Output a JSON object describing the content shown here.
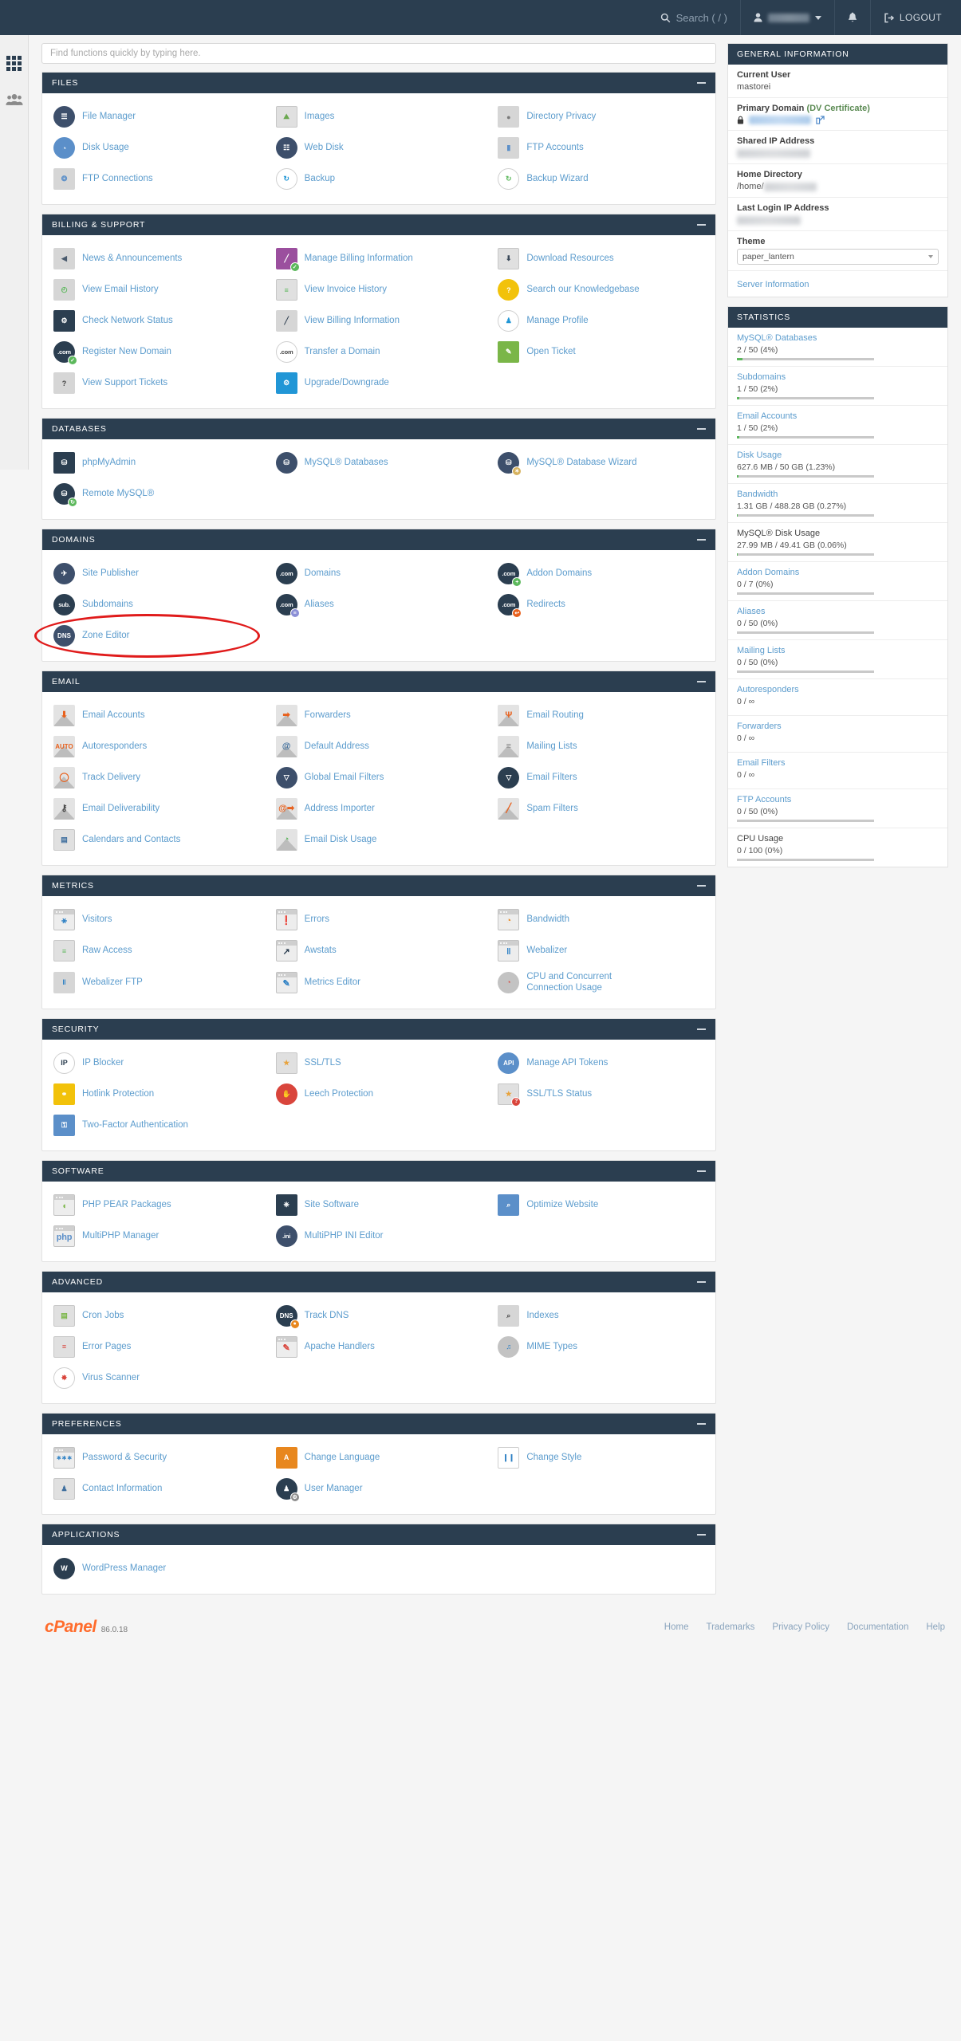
{
  "topnav": {
    "search_label": "Search ( / )",
    "search_icon": "search-icon",
    "user_name_redacted": "",
    "notifications_icon": "bell-icon",
    "logout_label": "LOGOUT"
  },
  "rail": {
    "items": [
      {
        "name": "apps-grid",
        "icon": "grid-icon"
      },
      {
        "name": "user-manager",
        "icon": "users-icon"
      }
    ]
  },
  "search": {
    "placeholder": "Find functions quickly by typing here."
  },
  "sections": [
    {
      "id": "files",
      "title": "FILES",
      "items": [
        {
          "label": "File Manager",
          "icon": "file-cabinet-icon",
          "cls": "ic circle ic-navy",
          "glyph": "☰"
        },
        {
          "label": "Images",
          "icon": "images-icon",
          "cls": "ic sq ic-silver",
          "glyph": "⛰",
          "gcolor": "#6aa84f"
        },
        {
          "label": "Directory Privacy",
          "icon": "folder-lock-icon",
          "cls": "ic sq ic-gray",
          "glyph": "●",
          "gcolor": "#7a7a7a"
        },
        {
          "label": "Disk Usage",
          "icon": "disk-usage-icon",
          "cls": "ic circle ic-ltblue",
          "glyph": "◔"
        },
        {
          "label": "Web Disk",
          "icon": "web-disk-icon",
          "cls": "ic circle ic-navy",
          "glyph": "☷"
        },
        {
          "label": "FTP Accounts",
          "icon": "ftp-truck-icon",
          "cls": "ic sq ic-gray",
          "glyph": "▮",
          "gcolor": "#5b8fc9"
        },
        {
          "label": "FTP Connections",
          "icon": "ftp-connections-icon",
          "cls": "ic sq ic-gray",
          "glyph": "❂",
          "gcolor": "#5b8fc9"
        },
        {
          "label": "Backup",
          "icon": "backup-icon",
          "cls": "ic circle ic-white",
          "glyph": "↻",
          "gcolor": "#2196d6"
        },
        {
          "label": "Backup Wizard",
          "icon": "backup-wizard-icon",
          "cls": "ic circle ic-white",
          "glyph": "↻",
          "gcolor": "#5cb85c"
        }
      ]
    },
    {
      "id": "billing",
      "title": "BILLING & SUPPORT",
      "items": [
        {
          "label": "News & Announcements",
          "icon": "megaphone-icon",
          "cls": "ic sq ic-gray",
          "glyph": "◀",
          "gcolor": "#4a5b6e"
        },
        {
          "label": "Manage Billing Information",
          "icon": "credit-card-icon",
          "cls": "ic sq ic-purple",
          "glyph": "╱",
          "badge": "✓",
          "bcolor": "#5cb85c"
        },
        {
          "label": "Download Resources",
          "icon": "download-doc-icon",
          "cls": "ic sq ic-silver",
          "glyph": "⬇",
          "gcolor": "#3b4a5a"
        },
        {
          "label": "View Email History",
          "icon": "email-history-icon",
          "cls": "ic sq ic-gray",
          "glyph": "◴",
          "gcolor": "#5cb85c"
        },
        {
          "label": "View Invoice History",
          "icon": "invoice-icon",
          "cls": "ic sq ic-silver",
          "glyph": "≡",
          "gcolor": "#5cb85c"
        },
        {
          "label": "Search our Knowledgebase",
          "icon": "lightbulb-icon",
          "cls": "ic circle ic-yellow",
          "glyph": "?"
        },
        {
          "label": "Check Network Status",
          "icon": "network-status-icon",
          "cls": "ic sq ic-dark",
          "glyph": "⚙"
        },
        {
          "label": "View Billing Information",
          "icon": "billing-card-icon",
          "cls": "ic sq ic-gray",
          "glyph": "╱",
          "gcolor": "#3b4a5a"
        },
        {
          "label": "Manage Profile",
          "icon": "profile-icon",
          "cls": "ic circle ic-white",
          "glyph": "♟",
          "gcolor": "#2196d6"
        },
        {
          "label": "Register New Domain",
          "icon": "register-domain-icon",
          "cls": "ic circle ic-dark",
          "glyph": ".com",
          "badge": "✓",
          "bcolor": "#5cb85c"
        },
        {
          "label": "Transfer a Domain",
          "icon": "transfer-domain-icon",
          "cls": "ic circle ic-white",
          "glyph": ".com",
          "gcolor": "#444"
        },
        {
          "label": "Open Ticket",
          "icon": "ticket-icon",
          "cls": "ic sq ic-grn2",
          "glyph": "✎"
        },
        {
          "label": "View Support Tickets",
          "icon": "support-ticket-icon",
          "cls": "ic sq ic-gray",
          "glyph": "?",
          "gcolor": "#444"
        },
        {
          "label": "Upgrade/Downgrade",
          "icon": "upgrade-icon",
          "cls": "ic sq ic-blue",
          "glyph": "⚙"
        }
      ]
    },
    {
      "id": "databases",
      "title": "DATABASES",
      "items": [
        {
          "label": "phpMyAdmin",
          "icon": "phpmyadmin-icon",
          "cls": "ic sq ic-dark",
          "glyph": "⛁"
        },
        {
          "label": "MySQL® Databases",
          "icon": "mysql-db-icon",
          "cls": "ic circle ic-navy",
          "glyph": "⛁"
        },
        {
          "label": "MySQL® Database Wizard",
          "icon": "mysql-wizard-icon",
          "cls": "ic circle ic-navy",
          "glyph": "⛁",
          "badge": "✶",
          "bcolor": "#d6b25e"
        },
        {
          "label": "Remote MySQL®",
          "icon": "remote-mysql-icon",
          "cls": "ic circle ic-dark",
          "glyph": "⛁",
          "badge": "↻",
          "bcolor": "#5cb85c"
        }
      ]
    },
    {
      "id": "domains",
      "title": "DOMAINS",
      "items": [
        {
          "label": "Site Publisher",
          "icon": "site-publisher-icon",
          "cls": "ic circle ic-navy",
          "glyph": "✈"
        },
        {
          "label": "Domains",
          "icon": "domains-icon",
          "cls": "ic circle ic-dark",
          "glyph": ".com"
        },
        {
          "label": "Addon Domains",
          "icon": "addon-domains-icon",
          "cls": "ic circle ic-dark",
          "glyph": ".com",
          "badge": "+",
          "bcolor": "#5cb85c"
        },
        {
          "label": "Subdomains",
          "icon": "subdomains-icon",
          "cls": "ic circle ic-dark",
          "glyph": "sub."
        },
        {
          "label": "Aliases",
          "icon": "aliases-icon",
          "cls": "ic circle ic-dark",
          "glyph": ".com",
          "badge": "≡",
          "bcolor": "#8b8fd6"
        },
        {
          "label": "Redirects",
          "icon": "redirects-icon",
          "cls": "ic circle ic-dark",
          "glyph": ".com",
          "badge": "↩",
          "bcolor": "#e8601c"
        },
        {
          "label": "Zone Editor",
          "icon": "zone-editor-icon",
          "cls": "ic circle ic-navy",
          "glyph": "DNS"
        }
      ]
    },
    {
      "id": "email",
      "title": "EMAIL",
      "items": [
        {
          "label": "Email Accounts",
          "icon": "email-accounts-icon",
          "cls": "ic env",
          "glyph": "⬇"
        },
        {
          "label": "Forwarders",
          "icon": "forwarders-icon",
          "cls": "ic env",
          "glyph": "➡"
        },
        {
          "label": "Email Routing",
          "icon": "email-routing-icon",
          "cls": "ic env",
          "glyph": "Ψ"
        },
        {
          "label": "Autoresponders",
          "icon": "autoresponders-icon",
          "cls": "ic env",
          "glyph": "AUTO"
        },
        {
          "label": "Default Address",
          "icon": "default-address-icon",
          "cls": "ic env",
          "glyph": "@",
          "gcolor": "#3f6f9e"
        },
        {
          "label": "Mailing Lists",
          "icon": "mailing-lists-icon",
          "cls": "ic env",
          "glyph": "≡",
          "gcolor": "#8c8c8c"
        },
        {
          "label": "Track Delivery",
          "icon": "track-delivery-icon",
          "cls": "ic env",
          "glyph": "◯"
        },
        {
          "label": "Global Email Filters",
          "icon": "global-filters-icon",
          "cls": "ic circle ic-navy",
          "glyph": "▽"
        },
        {
          "label": "Email Filters",
          "icon": "email-filters-icon",
          "cls": "ic circle ic-dark",
          "glyph": "▽"
        },
        {
          "label": "Email Deliverability",
          "icon": "deliverability-icon",
          "cls": "ic env",
          "glyph": "⚷",
          "gcolor": "#444"
        },
        {
          "label": "Address Importer",
          "icon": "address-importer-icon",
          "cls": "ic env",
          "glyph": "@➡"
        },
        {
          "label": "Spam Filters",
          "icon": "spam-filters-icon",
          "cls": "ic env",
          "glyph": "╱"
        },
        {
          "label": "Calendars and Contacts",
          "icon": "calendar-icon",
          "cls": "ic sq ic-silver",
          "glyph": "▤",
          "gcolor": "#3f6f9e"
        },
        {
          "label": "Email Disk Usage",
          "icon": "email-disk-usage-icon",
          "cls": "ic env",
          "glyph": "◔",
          "gcolor": "#5cb85c"
        }
      ]
    },
    {
      "id": "metrics",
      "title": "METRICS",
      "items": [
        {
          "label": "Visitors",
          "icon": "visitors-icon",
          "cls": "ic win",
          "glyph": "⚹",
          "gcolor": "#2b7fc4"
        },
        {
          "label": "Errors",
          "icon": "errors-icon",
          "cls": "ic win",
          "glyph": "❗",
          "gcolor": "#d9453c"
        },
        {
          "label": "Bandwidth",
          "icon": "bandwidth-icon",
          "cls": "ic win",
          "glyph": "◔",
          "gcolor": "#e8871e"
        },
        {
          "label": "Raw Access",
          "icon": "raw-access-icon",
          "cls": "ic sq ic-silver",
          "glyph": "≡",
          "gcolor": "#5cb85c"
        },
        {
          "label": "Awstats",
          "icon": "awstats-icon",
          "cls": "ic win",
          "glyph": "↗",
          "gcolor": "#2b3e50"
        },
        {
          "label": "Webalizer",
          "icon": "webalizer-icon",
          "cls": "ic win",
          "glyph": "‖",
          "gcolor": "#2b7fc4"
        },
        {
          "label": "Webalizer FTP",
          "icon": "webalizer-ftp-icon",
          "cls": "ic sq ic-gray",
          "glyph": "‖",
          "gcolor": "#2b7fc4"
        },
        {
          "label": "Metrics Editor",
          "icon": "metrics-editor-icon",
          "cls": "ic win",
          "glyph": "✎",
          "gcolor": "#2b7fc4"
        },
        {
          "label": "CPU and Concurrent Connection Usage",
          "icon": "cpu-usage-icon",
          "cls": "ic circle ic-gray2",
          "glyph": "◔",
          "gcolor": "#d9453c",
          "two_line": true
        }
      ]
    },
    {
      "id": "security",
      "title": "SECURITY",
      "items": [
        {
          "label": "IP Blocker",
          "icon": "ip-blocker-icon",
          "cls": "ic circle ic-white",
          "glyph": "IP",
          "gcolor": "#2b3e50"
        },
        {
          "label": "SSL/TLS",
          "icon": "certificate-icon",
          "cls": "ic sq ic-silver",
          "glyph": "★",
          "gcolor": "#e8a33d"
        },
        {
          "label": "Manage API Tokens",
          "icon": "api-tokens-icon",
          "cls": "ic circle ic-ltblue",
          "glyph": "API"
        },
        {
          "label": "Hotlink Protection",
          "icon": "hotlink-lock-icon",
          "cls": "ic sq ic-yellow",
          "glyph": "⚭"
        },
        {
          "label": "Leech Protection",
          "icon": "leech-hand-icon",
          "cls": "ic circle ic-red",
          "glyph": "✋"
        },
        {
          "label": "SSL/TLS Status",
          "icon": "ssl-status-icon",
          "cls": "ic sq ic-silver",
          "glyph": "★",
          "gcolor": "#e8a33d",
          "badge": "?",
          "bcolor": "#d9453c"
        },
        {
          "label": "Two-Factor Authentication",
          "icon": "two-factor-icon",
          "cls": "ic sq ic-ltblue",
          "glyph": "⚿"
        }
      ]
    },
    {
      "id": "software",
      "title": "SOFTWARE",
      "items": [
        {
          "label": "PHP PEAR Packages",
          "icon": "php-pear-icon",
          "cls": "ic win",
          "glyph": "◖",
          "gcolor": "#7ab648"
        },
        {
          "label": "Site Software",
          "icon": "site-software-icon",
          "cls": "ic sq ic-dark",
          "glyph": "❈"
        },
        {
          "label": "Optimize Website",
          "icon": "optimize-icon",
          "cls": "ic sq ic-ltblue",
          "glyph": "⌕"
        },
        {
          "label": "MultiPHP Manager",
          "icon": "multiphp-icon",
          "cls": "ic win",
          "glyph": "php",
          "gcolor": "#5b8fc9"
        },
        {
          "label": "MultiPHP INI Editor",
          "icon": "multiphp-ini-icon",
          "cls": "ic circle ic-navy",
          "glyph": ".ini"
        }
      ]
    },
    {
      "id": "advanced",
      "title": "ADVANCED",
      "items": [
        {
          "label": "Cron Jobs",
          "icon": "cron-jobs-icon",
          "cls": "ic sq ic-silver",
          "glyph": "▤",
          "gcolor": "#7ab648"
        },
        {
          "label": "Track DNS",
          "icon": "track-dns-icon",
          "cls": "ic circle ic-dark",
          "glyph": "DNS",
          "badge": "●",
          "bcolor": "#e8871e"
        },
        {
          "label": "Indexes",
          "icon": "indexes-icon",
          "cls": "ic sq ic-gray",
          "glyph": "⌕",
          "gcolor": "#4a4a4a"
        },
        {
          "label": "Error Pages",
          "icon": "error-pages-icon",
          "cls": "ic sq ic-silver",
          "glyph": "≡",
          "gcolor": "#d9453c"
        },
        {
          "label": "Apache Handlers",
          "icon": "apache-handlers-icon",
          "cls": "ic win",
          "glyph": "✎",
          "gcolor": "#d9453c"
        },
        {
          "label": "MIME Types",
          "icon": "mime-types-icon",
          "cls": "ic circle ic-gray2",
          "glyph": "♫",
          "gcolor": "#2b7fc4"
        },
        {
          "label": "Virus Scanner",
          "icon": "virus-scanner-icon",
          "cls": "ic circle ic-white",
          "glyph": "✸",
          "gcolor": "#d9453c"
        }
      ]
    },
    {
      "id": "preferences",
      "title": "PREFERENCES",
      "items": [
        {
          "label": "Password & Security",
          "icon": "password-icon",
          "cls": "ic win",
          "glyph": "∗∗∗",
          "gcolor": "#2b7fc4"
        },
        {
          "label": "Change Language",
          "icon": "language-icon",
          "cls": "ic sq ic-orange",
          "glyph": "A"
        },
        {
          "label": "Change Style",
          "icon": "change-style-icon",
          "cls": "ic sq ic-white",
          "glyph": "❙❙",
          "gcolor": "#2b7fc4"
        },
        {
          "label": "Contact Information",
          "icon": "contact-info-icon",
          "cls": "ic sq ic-silver",
          "glyph": "♟",
          "gcolor": "#3f6f9e"
        },
        {
          "label": "User Manager",
          "icon": "user-manager-icon",
          "cls": "ic circle ic-dark",
          "glyph": "♟",
          "badge": "⚙",
          "bcolor": "#8c8c8c"
        }
      ]
    },
    {
      "id": "applications",
      "title": "APPLICATIONS",
      "items": [
        {
          "label": "WordPress Manager",
          "icon": "wordpress-icon",
          "cls": "ic circle ic-dark",
          "glyph": "W"
        }
      ]
    }
  ],
  "general_information": {
    "title": "GENERAL INFORMATION",
    "rows": [
      {
        "label": "Current User",
        "value": "mastorei",
        "type": "text"
      },
      {
        "label": "Primary Domain",
        "suffix": "(DV Certificate)",
        "value": "",
        "type": "domain-redacted"
      },
      {
        "label": "Shared IP Address",
        "value": "",
        "type": "redacted"
      },
      {
        "label": "Home Directory",
        "value": "/home/",
        "type": "path-redacted"
      },
      {
        "label": "Last Login IP Address",
        "value": "",
        "type": "redacted"
      }
    ],
    "theme_label": "Theme",
    "theme_value": "paper_lantern",
    "server_information_link": "Server Information"
  },
  "statistics": {
    "title": "STATISTICS",
    "items": [
      {
        "label": "MySQL® Databases",
        "value": "2 / 50  (4%)",
        "pct": 4,
        "link": true
      },
      {
        "label": "Subdomains",
        "value": "1 / 50  (2%)",
        "pct": 2,
        "link": true
      },
      {
        "label": "Email Accounts",
        "value": "1 / 50  (2%)",
        "pct": 2,
        "link": true
      },
      {
        "label": "Disk Usage",
        "value": "627.6 MB / 50 GB  (1.23%)",
        "pct": 1.23,
        "link": true
      },
      {
        "label": "Bandwidth",
        "value": "1.31 GB / 488.28 GB  (0.27%)",
        "pct": 0.27,
        "link": true
      },
      {
        "label": "MySQL® Disk Usage",
        "value": "27.99 MB / 49.41 GB  (0.06%)",
        "pct": 0.06,
        "link": false
      },
      {
        "label": "Addon Domains",
        "value": "0 / 7  (0%)",
        "pct": 0,
        "link": true
      },
      {
        "label": "Aliases",
        "value": "0 / 50  (0%)",
        "pct": 0,
        "link": true
      },
      {
        "label": "Mailing Lists",
        "value": "0 / 50  (0%)",
        "pct": 0,
        "link": true
      },
      {
        "label": "Autoresponders",
        "value": "0 / ∞",
        "pct": -1,
        "link": true
      },
      {
        "label": "Forwarders",
        "value": "0 / ∞",
        "pct": -1,
        "link": true
      },
      {
        "label": "Email Filters",
        "value": "0 / ∞",
        "pct": -1,
        "link": true
      },
      {
        "label": "FTP Accounts",
        "value": "0 / 50  (0%)",
        "pct": 0,
        "link": true
      },
      {
        "label": "CPU Usage",
        "value": "0 / 100  (0%)",
        "pct": 0,
        "link": false
      }
    ]
  },
  "footer": {
    "brand": "cPanel",
    "version": "86.0.18",
    "links": [
      "Home",
      "Trademarks",
      "Privacy Policy",
      "Documentation",
      "Help"
    ]
  },
  "annotation": {
    "shape": "ellipse",
    "color": "#e01b1b",
    "target": "Zone Editor"
  }
}
